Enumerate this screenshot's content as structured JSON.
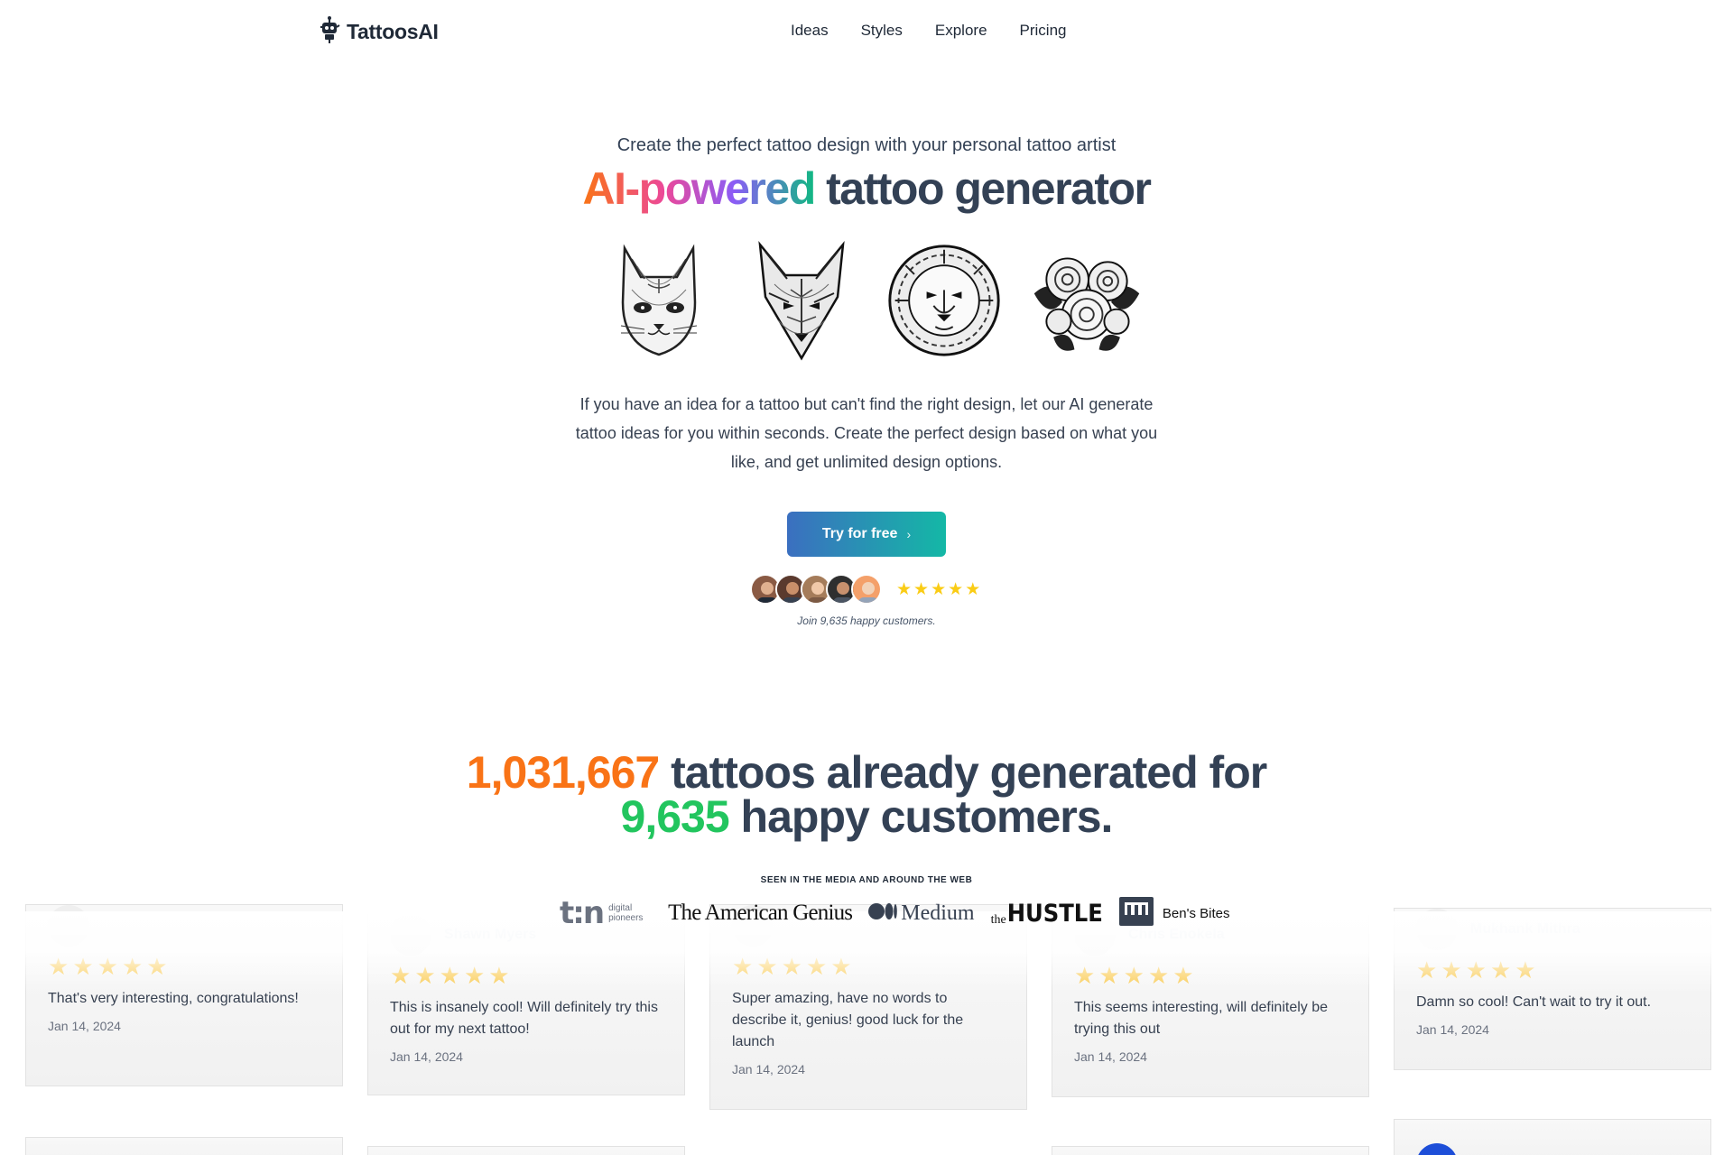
{
  "brand": {
    "name": "TattoosAI",
    "logo_icon": "robot-icon"
  },
  "nav": {
    "items": [
      "Ideas",
      "Styles",
      "Explore",
      "Pricing"
    ]
  },
  "hero": {
    "subtitle": "Create the perfect tattoo design with your personal tattoo artist",
    "title_gradient": "AI-powered",
    "title_rest": " tattoo generator",
    "gallery": [
      {
        "icon": "cat-tattoo-icon"
      },
      {
        "icon": "wolf-tattoo-icon"
      },
      {
        "icon": "lion-tattoo-icon"
      },
      {
        "icon": "roses-tattoo-icon"
      }
    ],
    "description": "If you have an idea for a tattoo but can't find the right design, let our AI generate tattoo ideas for you within seconds. Create the perfect design based on what you like, and get unlimited design options.",
    "cta_label": "Try for free",
    "cta_chevron": "›",
    "rating_stars": 5,
    "join_text": "Join 9,635 happy customers."
  },
  "stats": {
    "tattoos_count": "1,031,667",
    "mid_text": " tattoos already generated for",
    "customers_count": "9,635",
    "end_text": " happy customers."
  },
  "media": {
    "label": "SEEN IN THE MEDIA AND AROUND THE WEB",
    "logos": [
      "t:n",
      "digital pioneers",
      "The American Genius",
      "Medium",
      "the",
      "HUSTLE",
      "Ben's Bites"
    ]
  },
  "reviews": [
    {
      "name": "",
      "text": "That's very interesting, congratulations!",
      "date": "Jan 14, 2024",
      "stars": 5
    },
    {
      "name": "Shawn Myers",
      "text": "This is insanely cool! Will definitely try this out for my next tattoo!",
      "date": "Jan 14, 2024",
      "stars": 5
    },
    {
      "name": "",
      "text": "Super amazing, have no words to describe it, genius! good luck for the launch",
      "date": "Jan 14, 2024",
      "stars": 5
    },
    {
      "name": "Chris Enokela",
      "text": "This seems interesting, will definitely be trying this out",
      "date": "Jan 14, 2024",
      "stars": 5
    },
    {
      "name": "Mukhank Mithra",
      "text": "Damn so cool! Can't wait to try it out.",
      "date": "Jan 14, 2024",
      "stars": 5
    }
  ],
  "colors": {
    "accent_orange": "#f97316",
    "accent_green": "#22c55e",
    "cta_start": "#3b6fc0",
    "cta_end": "#14b8a6",
    "star": "#facc15"
  }
}
